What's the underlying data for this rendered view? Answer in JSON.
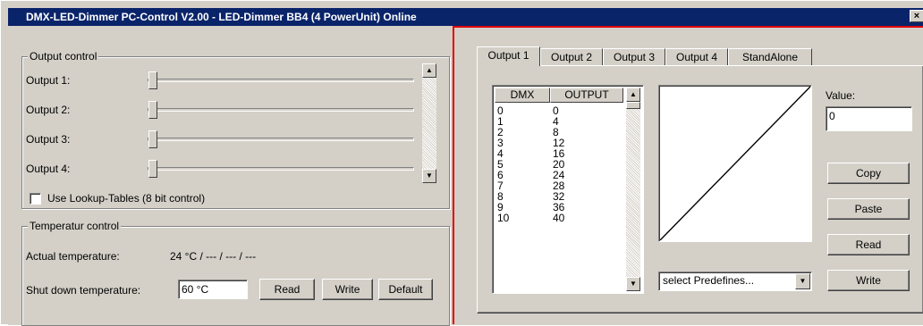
{
  "window": {
    "title": "DMX-LED-Dimmer PC-Control V2.00 - LED-Dimmer BB4 (4 PowerUnit) Online",
    "close_glyph": "×"
  },
  "output_control": {
    "title": "Output control",
    "outputs": [
      {
        "label": "Output 1:",
        "level": 0
      },
      {
        "label": "Output 2:",
        "level": 0
      },
      {
        "label": "Output 3:",
        "level": 0
      },
      {
        "label": "Output 4:",
        "level": 0
      }
    ],
    "lookup_checkbox": {
      "label": "Use Lookup-Tables (8 bit control)",
      "checked": false
    }
  },
  "temperature_control": {
    "title": "Temperatur control",
    "actual_label": "Actual temperature:",
    "actual_value": "24 °C / --- / --- / ---",
    "shutdown_label": "Shut down temperature:",
    "shutdown_value": "60 °C",
    "read_button": "Read",
    "write_button": "Write",
    "default_button": "Default"
  },
  "tabs": {
    "items": [
      "Output 1",
      "Output 2",
      "Output 3",
      "Output 4",
      "StandAlone"
    ],
    "active": "Output 1"
  },
  "lookup_table": {
    "columns": [
      "DMX",
      "OUTPUT"
    ],
    "rows": [
      [
        "0",
        "0"
      ],
      [
        "1",
        "4"
      ],
      [
        "2",
        "8"
      ],
      [
        "3",
        "12"
      ],
      [
        "4",
        "16"
      ],
      [
        "5",
        "20"
      ],
      [
        "6",
        "24"
      ],
      [
        "7",
        "28"
      ],
      [
        "8",
        "32"
      ],
      [
        "9",
        "36"
      ],
      [
        "10",
        "40"
      ]
    ]
  },
  "value_panel": {
    "label": "Value:",
    "value": "0",
    "copy_button": "Copy",
    "paste_button": "Paste",
    "read_button": "Read",
    "write_button": "Write"
  },
  "predefines": {
    "selected": "select Predefines..."
  },
  "icons": {
    "scroll_up": "▲",
    "scroll_down": "▼",
    "dropdown": "▼"
  },
  "colors": {
    "titlebar": "#0a246a",
    "face": "#d4d0c8",
    "highlight_frame": "#e00000"
  }
}
